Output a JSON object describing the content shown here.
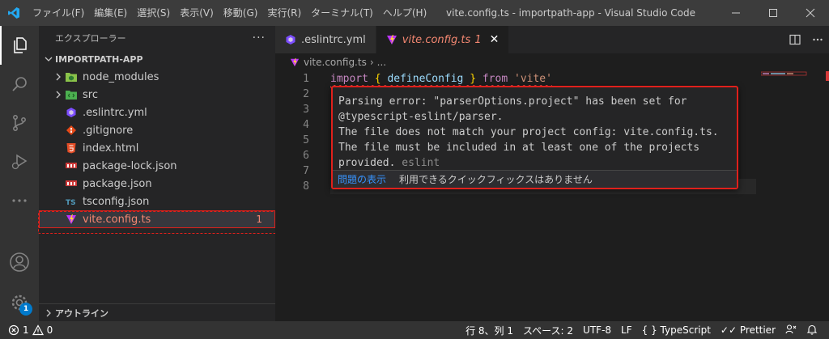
{
  "titlebar": {
    "menu": [
      "ファイル(F)",
      "編集(E)",
      "選択(S)",
      "表示(V)",
      "移動(G)",
      "実行(R)",
      "ターミナル(T)",
      "ヘルプ(H)"
    ],
    "window_title": "vite.config.ts - importpath-app - Visual Studio Code"
  },
  "activity_badge": "1",
  "sidebar": {
    "header": "エクスプローラー",
    "more": "···",
    "project": "IMPORTPATH-APP",
    "items": [
      {
        "name": "node_modules",
        "icon": "node-folder-icon",
        "color": "#8bc34a"
      },
      {
        "name": "src",
        "icon": "src-folder-icon",
        "color": "#4caf50"
      },
      {
        "name": ".eslintrc.yml",
        "icon": "eslint-icon",
        "color": "#7c4dff"
      },
      {
        "name": ".gitignore",
        "icon": "git-icon",
        "color": "#e64a19"
      },
      {
        "name": "index.html",
        "icon": "html-icon",
        "color": "#e44d26"
      },
      {
        "name": "package-lock.json",
        "icon": "npm-icon",
        "color": "#cb3837"
      },
      {
        "name": "package.json",
        "icon": "npm-icon",
        "color": "#cb3837"
      },
      {
        "name": "tsconfig.json",
        "icon": "ts-icon",
        "color": "#519aba"
      },
      {
        "name": "vite.config.ts",
        "icon": "vite-icon",
        "color": "#bd34fe",
        "problems": "1"
      }
    ],
    "outline": "アウトライン"
  },
  "tabs": [
    {
      "label": ".eslintrc.yml",
      "active": false
    },
    {
      "label": "vite.config.ts",
      "problems": "1",
      "active": true
    }
  ],
  "breadcrumb": {
    "file": "vite.config.ts",
    "rest": "..."
  },
  "code": {
    "line_numbers": [
      "1",
      "2",
      "3",
      "4",
      "5",
      "6",
      "7",
      "8"
    ],
    "line1": {
      "kw1": "import",
      "open": "{",
      "name": "defineConfig",
      "close": "}",
      "kw2": "from",
      "str": "'vite'"
    }
  },
  "hover": {
    "lines": [
      "Parsing error: \"parserOptions.project\" has been set for",
      "@typescript-eslint/parser.",
      "The file does not match your project config: vite.config.ts.",
      "The file must be included in at least one of the projects",
      "provided."
    ],
    "source": "eslint",
    "view_problem": "問題の表示",
    "no_quick_fix": "利用できるクイックフィックスはありません"
  },
  "status": {
    "errors": "1",
    "warnings": "0",
    "position": "行 8、列 1",
    "spaces": "スペース: 2",
    "encoding": "UTF-8",
    "eol": "LF",
    "language": "TypeScript",
    "prettier": "Prettier"
  }
}
